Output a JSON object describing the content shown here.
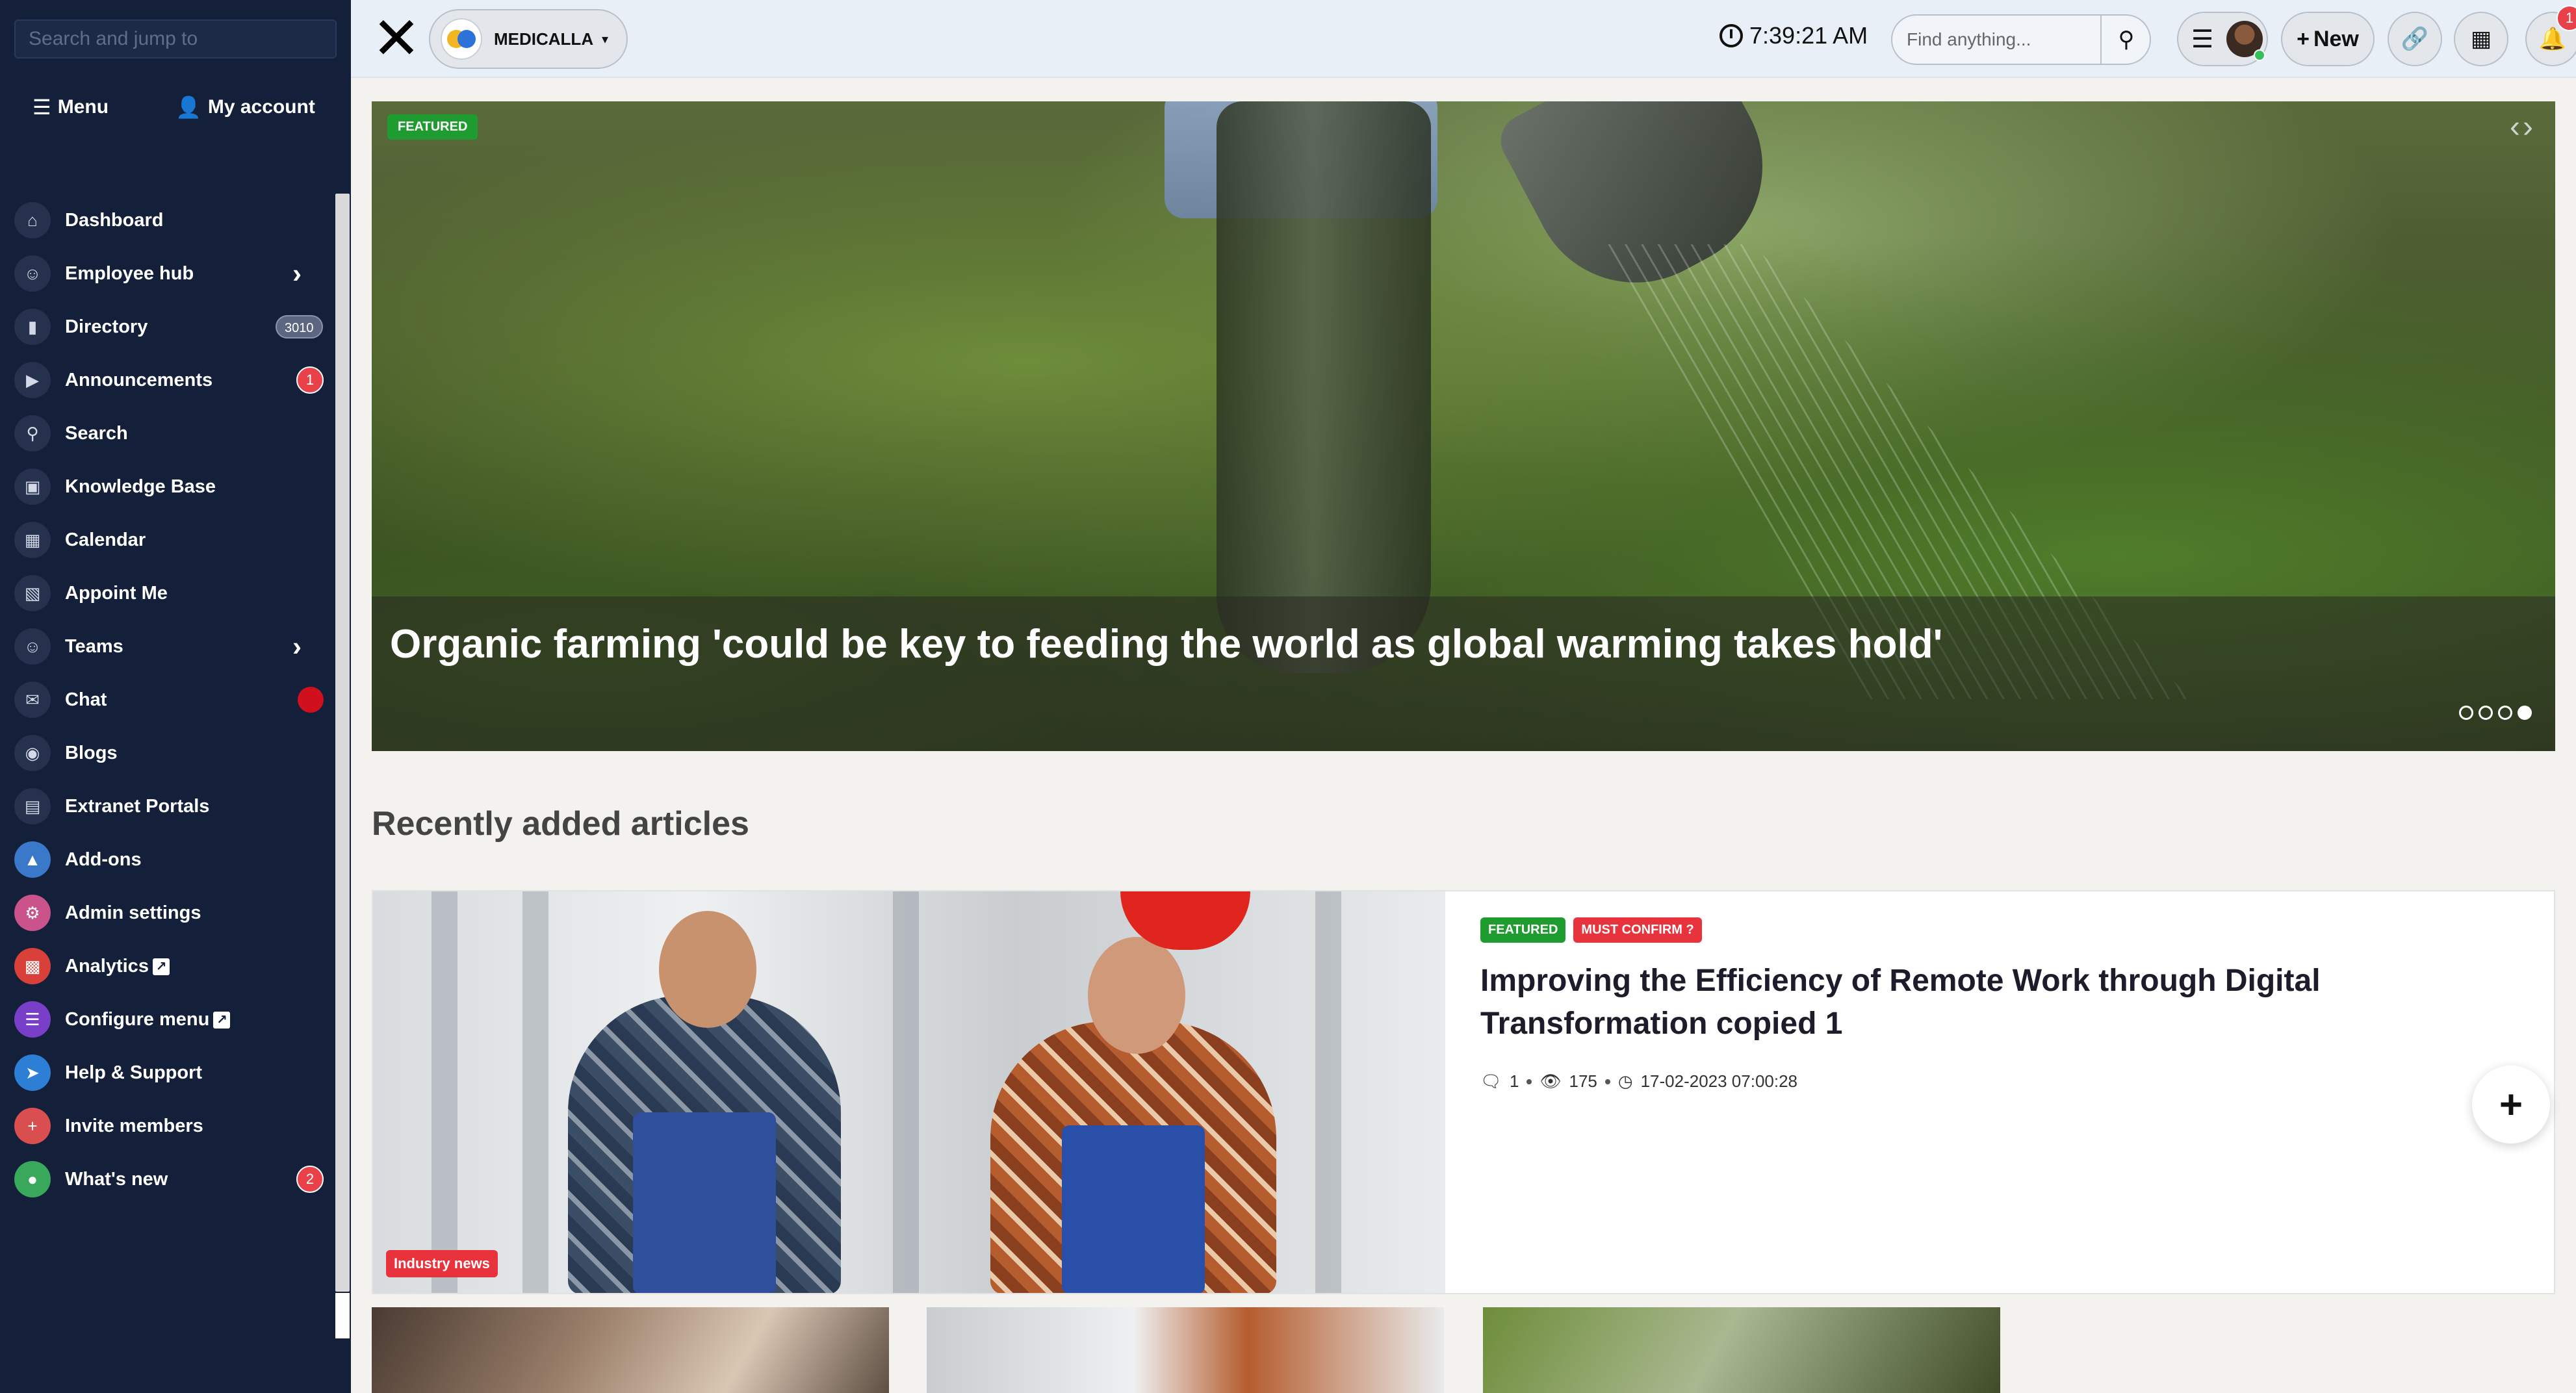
{
  "sidebar": {
    "search_placeholder": "Search and jump to",
    "tabs": {
      "menu": "Menu",
      "account": "My account"
    },
    "items": [
      {
        "label": "Dashboard",
        "icon": "home-icon"
      },
      {
        "label": "Employee hub",
        "icon": "people-icon",
        "has_submenu": true
      },
      {
        "label": "Directory",
        "icon": "book-icon",
        "badge": "3010"
      },
      {
        "label": "Announcements",
        "icon": "megaphone-icon",
        "badge": "1"
      },
      {
        "label": "Search",
        "icon": "search-icon"
      },
      {
        "label": "Knowledge Base",
        "icon": "folder-icon"
      },
      {
        "label": "Calendar",
        "icon": "calendar-icon"
      },
      {
        "label": "Appoint Me",
        "icon": "table-icon"
      },
      {
        "label": "Teams",
        "icon": "people-icon",
        "has_submenu": true
      },
      {
        "label": "Chat",
        "icon": "chat-icon"
      },
      {
        "label": "Blogs",
        "icon": "rss-icon"
      },
      {
        "label": "Extranet Portals",
        "icon": "portal-icon"
      },
      {
        "label": "Add-ons",
        "icon": "addons-icon",
        "color": "#3a78c9"
      },
      {
        "label": "Admin settings",
        "icon": "settings-icon",
        "color": "#c9538a"
      },
      {
        "label": "Analytics",
        "icon": "chart-icon",
        "color": "#d9403a",
        "external": true
      },
      {
        "label": "Configure menu",
        "icon": "list-icon",
        "color": "#7a3fc9",
        "external": true
      },
      {
        "label": "Help & Support",
        "icon": "rocket-icon",
        "color": "#2c7fd4"
      },
      {
        "label": "Invite members",
        "icon": "user-plus-icon",
        "color": "#d94f4f"
      },
      {
        "label": "What's new",
        "icon": "bulb-icon",
        "color": "#3aa85a",
        "badge": "2"
      }
    ]
  },
  "topbar": {
    "brand": "MEDICALLA",
    "time": "7:39:21 AM",
    "find_placeholder": "Find anything...",
    "new_label": "New",
    "notifications_count": "1"
  },
  "hero": {
    "badge": "FEATURED",
    "title": "Organic farming 'could be key to feeding the world as global warming takes hold'",
    "slide_count": 4,
    "active_slide": 4
  },
  "recent": {
    "title": "Recently added articles",
    "article": {
      "badges": [
        "FEATURED",
        "MUST CONFIRM"
      ],
      "title": "Improving the Efficiency of Remote Work through Digital Transformation copied 1",
      "comments": "1",
      "views": "175",
      "date": "17-02-2023 07:00:28",
      "category": "Industry news"
    }
  },
  "colors": {
    "sidebar_bg": "#14203a",
    "badge_green": "#1f9c2f",
    "badge_red": "#e8333c"
  }
}
